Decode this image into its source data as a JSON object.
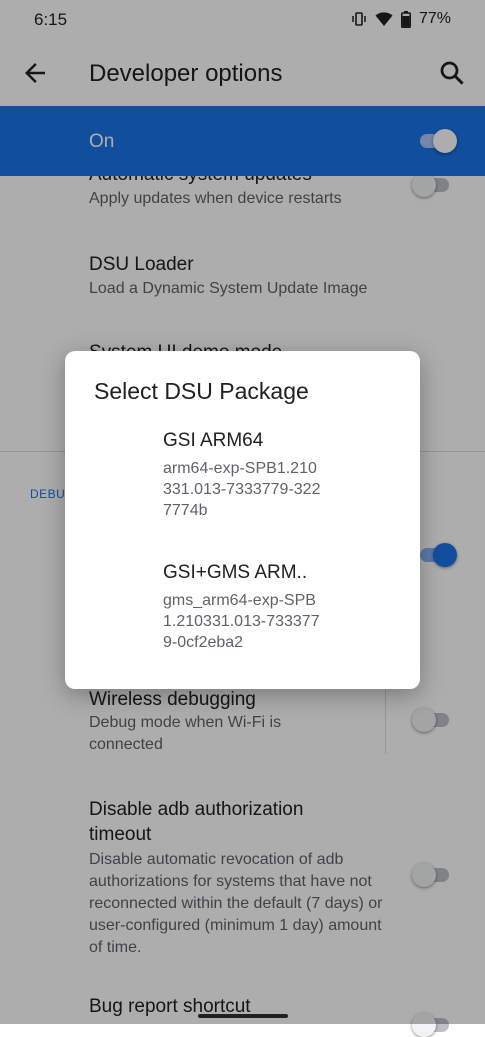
{
  "status_bar": {
    "time": "6:15",
    "battery": "77%"
  },
  "app_bar": {
    "title": "Developer options"
  },
  "master_switch": {
    "label": "On",
    "state": "on"
  },
  "settings": {
    "auto_updates": {
      "title": "Automatic system updates",
      "subtitle": "Apply updates when device restarts",
      "toggle": "off"
    },
    "dsu_loader": {
      "title": "DSU Loader",
      "subtitle": "Load a Dynamic System Update Image"
    },
    "system_ui_demo": {
      "title": "System UI demo mode"
    },
    "debugging_header": "DEBUGGING",
    "usb_debugging": {
      "toggle": "on"
    },
    "wireless_debugging": {
      "title": "Wireless debugging",
      "subtitle": "Debug mode when Wi-Fi is connected",
      "toggle": "off"
    },
    "adb_timeout": {
      "title": "Disable adb authorization timeout",
      "subtitle": "Disable automatic revocation of adb authorizations for systems that have not reconnected within the default (7 days) or user-configured (minimum 1 day) amount of time.",
      "toggle": "off"
    },
    "bug_report": {
      "title": "Bug report shortcut"
    }
  },
  "dialog": {
    "title": "Select DSU Package",
    "packages": [
      {
        "name": "GSI ARM64",
        "description": "arm64-exp-SPB1.210331.013-7333779-3227774b"
      },
      {
        "name": "GSI+GMS ARM..",
        "description": "gms_arm64-exp-SPB1.210331.013-7333779-0cf2eba2"
      }
    ]
  },
  "icons": {
    "back": "arrow-back-icon",
    "search": "search-icon",
    "vibrate": "vibrate-icon",
    "wifi": "wifi-icon",
    "battery": "battery-icon"
  },
  "colors": {
    "accent": "#1a73e8",
    "scrim": "rgba(0,0,0,0.32)"
  }
}
